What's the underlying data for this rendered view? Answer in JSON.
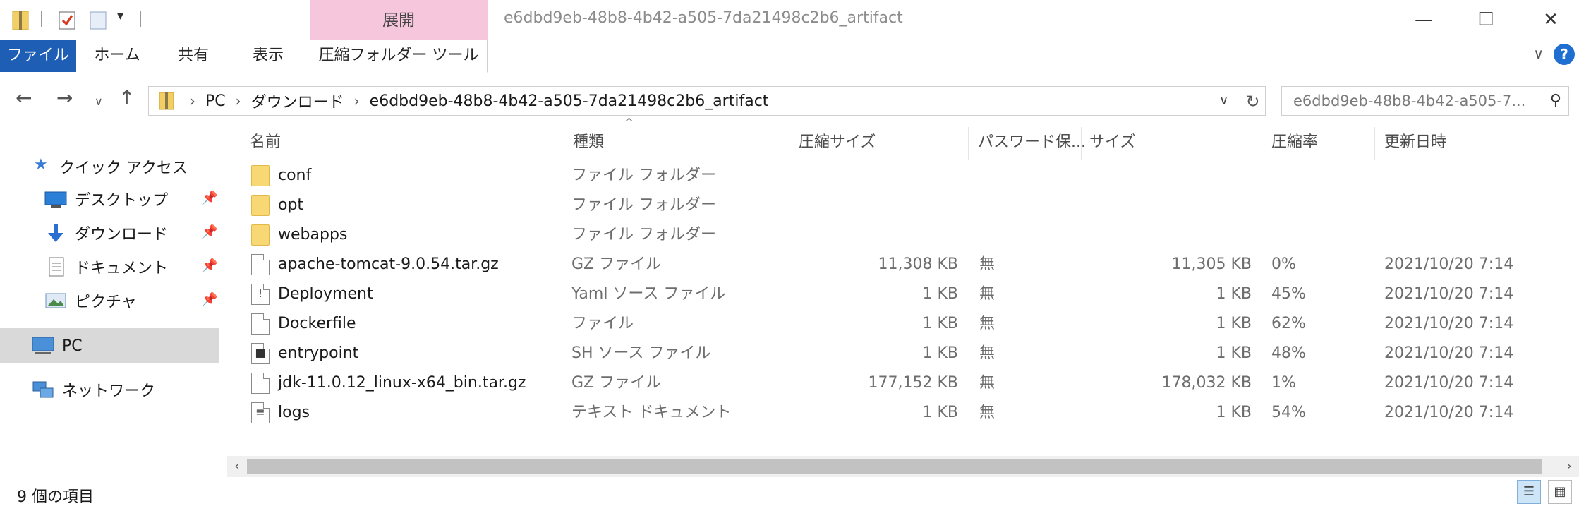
{
  "window": {
    "title": "e6dbd9eb-48b8-4b42-a505-7da21498c2b6_artifact",
    "context_tab_group": "展開"
  },
  "ribbon": {
    "tabs": [
      "ファイル",
      "ホーム",
      "共有",
      "表示",
      "圧縮フォルダー ツール"
    ]
  },
  "address": {
    "crumbs": [
      "PC",
      "ダウンロード",
      "e6dbd9eb-48b8-4b42-a505-7da21498c2b6_artifact"
    ],
    "search_placeholder": "e6dbd9eb-48b8-4b42-a505-7..."
  },
  "nav": {
    "quick_access": "クイック アクセス",
    "items": [
      "デスクトップ",
      "ダウンロード",
      "ドキュメント",
      "ピクチャ"
    ],
    "pc": "PC",
    "network": "ネットワーク"
  },
  "columns": [
    "名前",
    "種類",
    "圧縮サイズ",
    "パスワード保...",
    "サイズ",
    "圧縮率",
    "更新日時"
  ],
  "files": [
    {
      "name": "conf",
      "type": "ファイル フォルダー",
      "packed": "",
      "password": "",
      "size": "",
      "ratio": "",
      "modified": "",
      "icon": "folder-icon"
    },
    {
      "name": "opt",
      "type": "ファイル フォルダー",
      "packed": "",
      "password": "",
      "size": "",
      "ratio": "",
      "modified": "",
      "icon": "folder-icon"
    },
    {
      "name": "webapps",
      "type": "ファイル フォルダー",
      "packed": "",
      "password": "",
      "size": "",
      "ratio": "",
      "modified": "",
      "icon": "folder-icon"
    },
    {
      "name": "apache-tomcat-9.0.54.tar.gz",
      "type": "GZ ファイル",
      "packed": "11,308 KB",
      "password": "無",
      "size": "11,305 KB",
      "ratio": "0%",
      "modified": "2021/10/20 7:14",
      "icon": "file-icon"
    },
    {
      "name": "Deployment",
      "type": "Yaml ソース ファイル",
      "packed": "1 KB",
      "password": "無",
      "size": "1 KB",
      "ratio": "45%",
      "modified": "2021/10/20 7:14",
      "icon": "yaml-file-icon"
    },
    {
      "name": "Dockerfile",
      "type": "ファイル",
      "packed": "1 KB",
      "password": "無",
      "size": "1 KB",
      "ratio": "62%",
      "modified": "2021/10/20 7:14",
      "icon": "file-icon"
    },
    {
      "name": "entrypoint",
      "type": "SH ソース ファイル",
      "packed": "1 KB",
      "password": "無",
      "size": "1 KB",
      "ratio": "48%",
      "modified": "2021/10/20 7:14",
      "icon": "script-file-icon"
    },
    {
      "name": "jdk-11.0.12_linux-x64_bin.tar.gz",
      "type": "GZ ファイル",
      "packed": "177,152 KB",
      "password": "無",
      "size": "178,032 KB",
      "ratio": "1%",
      "modified": "2021/10/20 7:14",
      "icon": "file-icon"
    },
    {
      "name": "logs",
      "type": "テキスト ドキュメント",
      "packed": "1 KB",
      "password": "無",
      "size": "1 KB",
      "ratio": "54%",
      "modified": "2021/10/20 7:14",
      "icon": "text-file-icon"
    }
  ],
  "status": {
    "item_count": "9 個の項目"
  }
}
